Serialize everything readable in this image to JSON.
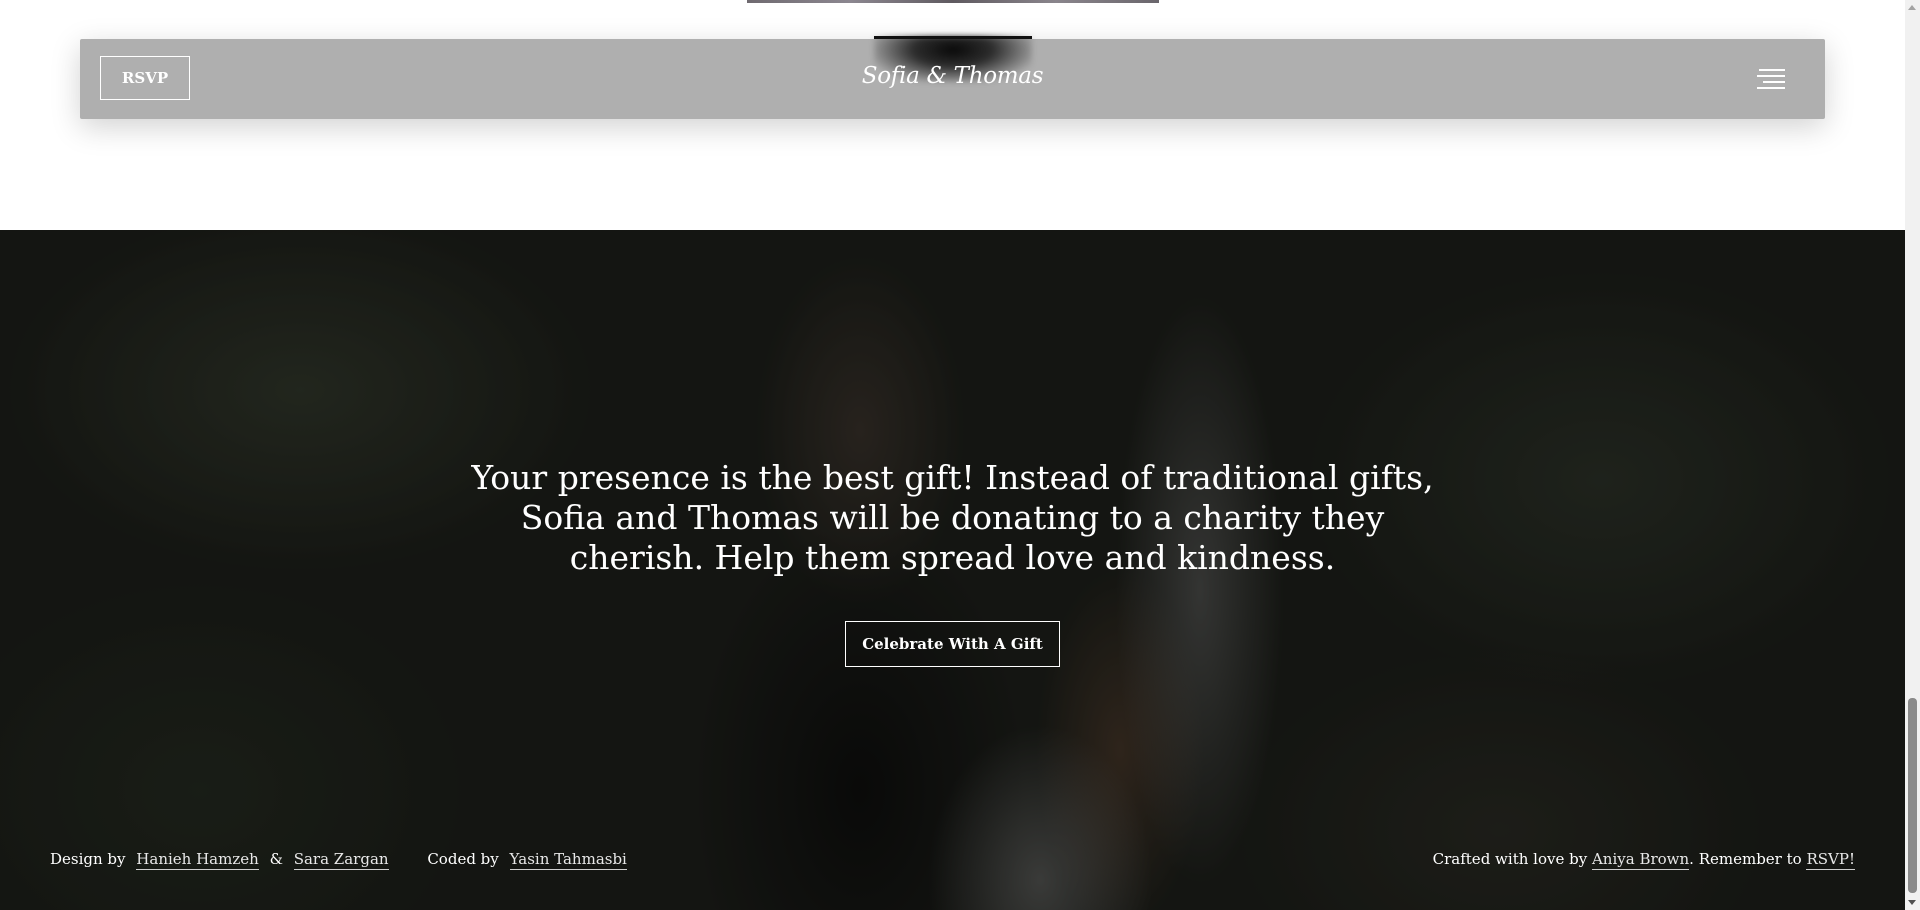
{
  "header": {
    "rsvp_label": "RSVP",
    "brand": "Sofia & Thomas",
    "menu_icon": "hamburger-menu-icon"
  },
  "hero": {
    "message": "Your presence is the best gift! Instead of traditional gifts, Sofia and Thomas will be donating to a charity they cherish. Help them spread love and kindness.",
    "gift_button_label": "Celebrate With A Gift"
  },
  "footer": {
    "design_prefix": "Design by",
    "designer_1": "Hanieh Hamzeh",
    "ampersand": "&",
    "designer_2": "Sara Zargan",
    "coded_prefix": "Coded by",
    "coder": "Yasin Tahmasbi",
    "crafted_prefix": "Crafted with love by",
    "crafter": "Aniya Brown",
    "remember_text": ". Remember to",
    "rsvp_link": "RSVP!"
  },
  "colors": {
    "navbar_bg": "#afafaf",
    "text": "#ffffff",
    "hero_overlay": "#1f211c"
  }
}
